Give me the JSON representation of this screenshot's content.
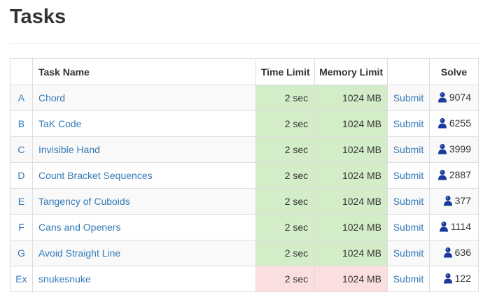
{
  "page": {
    "title": "Tasks"
  },
  "table": {
    "headers": {
      "id": "",
      "name": "Task Name",
      "time": "Time Limit",
      "memory": "Memory Limit",
      "submit": "",
      "solve": "Solve"
    },
    "colors": {
      "link": "#337ab7",
      "limit_ok": "#d4edc9",
      "limit_bad": "#fbdfe0",
      "user_icon": "#1a3a9c"
    },
    "rows": [
      {
        "id": "A",
        "name": "Chord",
        "time": "2 sec",
        "memory": "1024 MB",
        "submit": "Submit",
        "solve": "9074",
        "status": "ok"
      },
      {
        "id": "B",
        "name": "TaK Code",
        "time": "2 sec",
        "memory": "1024 MB",
        "submit": "Submit",
        "solve": "6255",
        "status": "ok"
      },
      {
        "id": "C",
        "name": "Invisible Hand",
        "time": "2 sec",
        "memory": "1024 MB",
        "submit": "Submit",
        "solve": "3999",
        "status": "ok"
      },
      {
        "id": "D",
        "name": "Count Bracket Sequences",
        "time": "2 sec",
        "memory": "1024 MB",
        "submit": "Submit",
        "solve": "2887",
        "status": "ok"
      },
      {
        "id": "E",
        "name": "Tangency of Cuboids",
        "time": "2 sec",
        "memory": "1024 MB",
        "submit": "Submit",
        "solve": "377",
        "status": "ok"
      },
      {
        "id": "F",
        "name": "Cans and Openers",
        "time": "2 sec",
        "memory": "1024 MB",
        "submit": "Submit",
        "solve": "1114",
        "status": "ok"
      },
      {
        "id": "G",
        "name": "Avoid Straight Line",
        "time": "2 sec",
        "memory": "1024 MB",
        "submit": "Submit",
        "solve": "636",
        "status": "ok"
      },
      {
        "id": "Ex",
        "name": "snukesnuke",
        "time": "2 sec",
        "memory": "1024 MB",
        "submit": "Submit",
        "solve": "122",
        "status": "bad"
      }
    ],
    "solve_icon": "user-icon"
  }
}
